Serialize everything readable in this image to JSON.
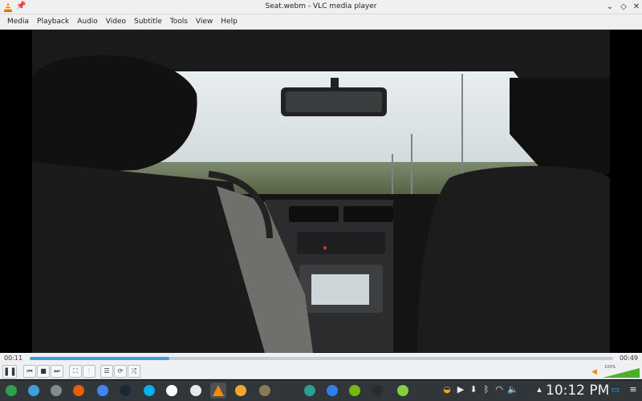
{
  "window": {
    "title": "Seat.webm - VLC media player",
    "pin_icon": "pin-icon",
    "controls": [
      "minimize",
      "maximize",
      "close"
    ]
  },
  "menu": [
    "Media",
    "Playback",
    "Audio",
    "Video",
    "Subtitle",
    "Tools",
    "View",
    "Help"
  ],
  "player": {
    "elapsed": "00:11",
    "total": "00:49",
    "progress": 0.24,
    "volume_label": "100%",
    "volume_level": 1.0
  },
  "controls": [
    {
      "name": "pause-icon",
      "glyph": "❚❚"
    },
    {
      "name": "previous-icon",
      "glyph": "⏮"
    },
    {
      "name": "stop-icon",
      "glyph": "■"
    },
    {
      "name": "next-icon",
      "glyph": "⏭"
    },
    {
      "name": "fullscreen-icon",
      "glyph": "⛶"
    },
    {
      "name": "extended-settings-icon",
      "glyph": "⫶"
    },
    {
      "name": "playlist-icon",
      "glyph": "☰"
    },
    {
      "name": "loop-icon",
      "glyph": "⟳"
    },
    {
      "name": "shuffle-icon",
      "glyph": "⤮"
    }
  ],
  "taskbar": {
    "clock": "10:12 PM",
    "apps": [
      {
        "name": "app-launcher-icon",
        "color": "#2e9e4f"
      },
      {
        "name": "dolphin-icon",
        "color": "#3d9fdd"
      },
      {
        "name": "files-icon",
        "color": "#7f8c8d"
      },
      {
        "name": "firefox-icon",
        "color": "#e66000"
      },
      {
        "name": "chrome-icon",
        "color": "#4285f4"
      },
      {
        "name": "steam-icon",
        "color": "#1b2838"
      },
      {
        "name": "skype-icon",
        "color": "#00aff0"
      },
      {
        "name": "document-icon",
        "color": "#ffffff"
      },
      {
        "name": "document-blocked-icon",
        "color": "#e8e8e8"
      },
      {
        "name": "vlc-icon",
        "color": "#f28c00"
      },
      {
        "name": "croissant-icon",
        "color": "#f4a62a"
      },
      {
        "name": "gimp-icon",
        "color": "#8a7a5a"
      },
      {
        "name": "inkscape-icon",
        "color": "#2e9e8f"
      },
      {
        "name": "safari-icon",
        "color": "#2f80ed"
      },
      {
        "name": "nvidia-icon",
        "color": "#76b900"
      },
      {
        "name": "terminal-icon",
        "color": "#2b2b2b"
      },
      {
        "name": "mint-icon",
        "color": "#87cf3e"
      }
    ],
    "tray": [
      "weather-icon",
      "play-icon",
      "download-icon",
      "bluetooth-icon",
      "wifi-icon",
      "volume-icon",
      "expand-tray-icon"
    ]
  },
  "colors": {
    "accent": "#3d9fdd",
    "taskbar": "#31363b",
    "chrome": "#eff0f1"
  }
}
